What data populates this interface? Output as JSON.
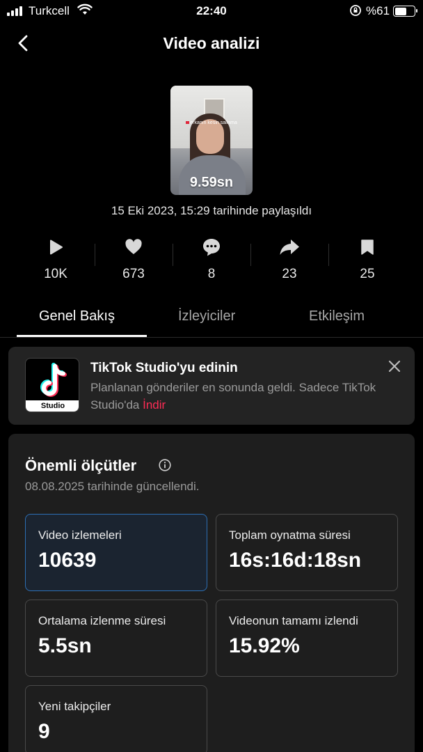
{
  "status_bar": {
    "carrier": "Turkcell",
    "time": "22:40",
    "battery": "%61"
  },
  "nav": {
    "title": "Video analizi"
  },
  "video": {
    "duration": "9.59sn",
    "caption": "erkanın kesin sallama",
    "posted": "15 Eki 2023, 15:29 tarihinde paylaşıldı"
  },
  "stats": {
    "views": "10K",
    "likes": "673",
    "comments": "8",
    "shares": "23",
    "saves": "25"
  },
  "tabs": [
    "Genel Bakış",
    "İzleyiciler",
    "Etkileşim"
  ],
  "promo": {
    "logo_text": "Studio",
    "headline": "TikTok Studio'yu edinin",
    "desc": "Planlanan gönderiler en sonunda geldi. Sadece TikTok Studio'da ",
    "download": "İndir"
  },
  "metrics": {
    "title": "Önemli ölçütler",
    "updated": "08.08.2025 tarihinde güncellendi.",
    "cards": [
      {
        "label": "Video izlemeleri",
        "value": "10639"
      },
      {
        "label": "Toplam oynatma süresi",
        "value": "16s:16d:18sn"
      },
      {
        "label": "Ortalama izlenme süresi",
        "value": "5.5sn"
      },
      {
        "label": "Videonun tamamı izlendi",
        "value": "15.92%"
      },
      {
        "label": "Yeni takipçiler",
        "value": "9"
      }
    ]
  },
  "colors": {
    "accent": "#fe2c55",
    "active_card_border": "#2d6fb4"
  }
}
